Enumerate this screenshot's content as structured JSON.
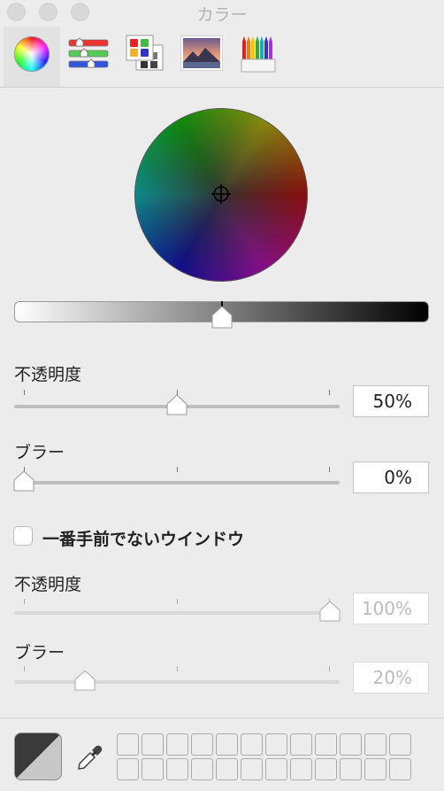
{
  "window": {
    "title": "カラー"
  },
  "toolbar": {
    "tabs": [
      {
        "name": "color-wheel"
      },
      {
        "name": "color-sliders"
      },
      {
        "name": "color-palettes"
      },
      {
        "name": "image-palettes"
      },
      {
        "name": "pencils"
      }
    ],
    "selected": "color-wheel"
  },
  "wheel": {
    "brightness_percent": 50
  },
  "section1": {
    "opacity_label": "不透明度",
    "opacity_value": "50%",
    "opacity_level": 0.5,
    "blur_label": "ブラー",
    "blur_value": "0%",
    "blur_level": 0.0
  },
  "checkbox": {
    "label": "一番手前でないウインドウ",
    "checked": false
  },
  "section2": {
    "opacity_label": "不透明度",
    "opacity_value": "100%",
    "opacity_level": 1.0,
    "blur_label": "ブラー",
    "blur_value": "20%",
    "blur_level": 0.2
  },
  "colors": {
    "current_dark": "#3a3a3a",
    "current_light": "#c8c8c8"
  }
}
